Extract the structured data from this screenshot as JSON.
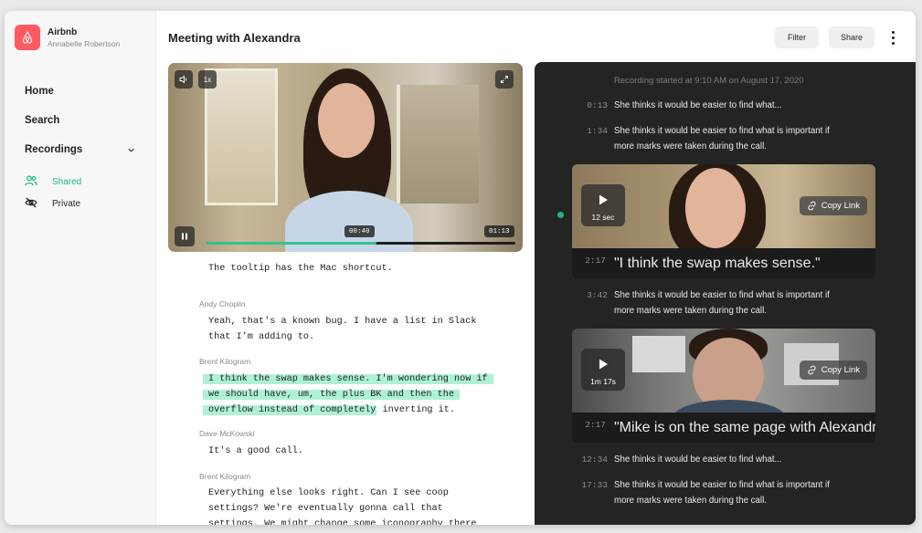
{
  "app": {
    "name": "Airbnb",
    "user": "Annabelle Robertson"
  },
  "sidebar": {
    "items": [
      {
        "label": "Home"
      },
      {
        "label": "Search"
      },
      {
        "label": "Recordings"
      }
    ],
    "sub_items": [
      {
        "label": "Shared",
        "icon": "users-icon",
        "active": true
      },
      {
        "label": "Private",
        "icon": "eye-off-icon",
        "active": false
      }
    ]
  },
  "header": {
    "title": "Meeting with Alexandra",
    "filter_label": "Filter",
    "share_label": "Share"
  },
  "player": {
    "speed": "1x",
    "current_time": "00:40",
    "duration": "01:13",
    "progress": 0.55
  },
  "transcript": {
    "first_line": "The tooltip has the Mac shortcut.",
    "entries": [
      {
        "speaker": "Andy Choplin",
        "lines": [
          "Yeah, that's a known bug. I have a list in Slack",
          "that I’m adding to."
        ]
      },
      {
        "speaker": "Brent Kilogram",
        "highlighted_lines": [
          "I think the swap makes sense. I'm wondering now if",
          "we should have, um, the plus BK and then the",
          "overflow instead of completely"
        ],
        "tail": " inverting it."
      },
      {
        "speaker": "Dave McKowski",
        "lines": [
          "It's a good call."
        ]
      },
      {
        "speaker": "Brent Kilogram",
        "lines": [
          "Everything else looks right. Can I see coop",
          "settings? We're eventually gonna call that",
          "settings. We might change some iconography there"
        ]
      }
    ]
  },
  "panel": {
    "recording_started": "Recording started at 9:10 AM on August 17, 2020",
    "rows": [
      {
        "time": "0:13",
        "lines": [
          "She thinks it would be easier to find what..."
        ]
      },
      {
        "time": "1:34",
        "lines": [
          "She thinks it would be easier to find what is important if",
          "more marks were taken during the call."
        ]
      }
    ],
    "clips": [
      {
        "duration": "12 sec",
        "time": "2:17",
        "caption": "\"I think the swap makes sense.\"",
        "copy_label": "Copy Link"
      },
      {
        "duration": "1m 17s",
        "time": "2:17",
        "caption": "\"Mike is on the same page with Alexandra\"",
        "copy_label": "Copy Link"
      }
    ],
    "mid_row": {
      "time": "3:42",
      "lines": [
        "She thinks it would be easier to find what is important if",
        "more marks were taken during the call."
      ]
    },
    "bottom_rows": [
      {
        "time": "12:34",
        "lines": [
          "She thinks it would be easier to find what..."
        ]
      },
      {
        "time": "17:33",
        "lines": [
          "She thinks it would be easier to find what is important if",
          "more marks were taken during the call."
        ]
      }
    ]
  },
  "colors": {
    "brand": "#ff5a5f",
    "accent": "#35c18d",
    "highlight": "#aef1d5",
    "panel": "#242424"
  }
}
